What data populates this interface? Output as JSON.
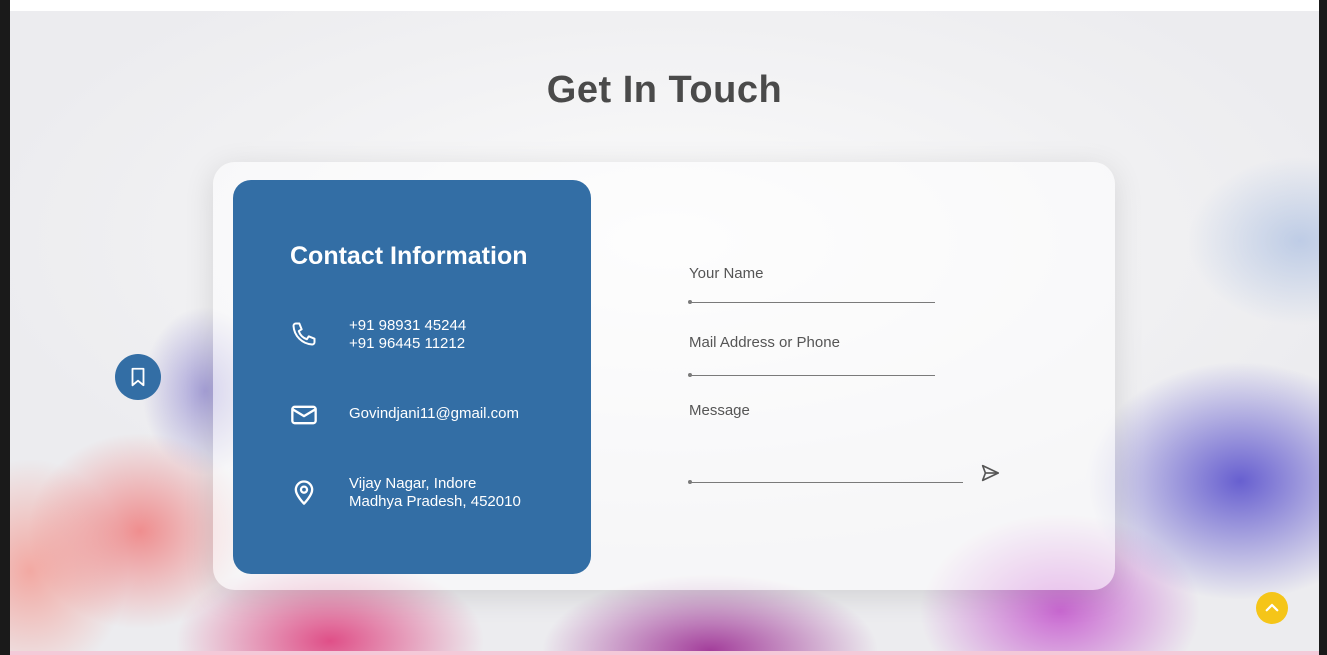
{
  "section": {
    "heading": "Get In Touch"
  },
  "contact_info": {
    "title": "Contact Information",
    "phone_1": "+91 98931 45244",
    "phone_2": "+91 96445 11212",
    "email": "Govindjani11@gmail.com",
    "address_line_1": "Vijay Nagar, Indore",
    "address_line_2": "Madhya Pradesh, 452010",
    "panel_color": "#336ea5"
  },
  "form": {
    "name_label": "Your Name",
    "contact_label": "Mail Address or Phone",
    "message_label": "Message",
    "send_icon": "send-icon"
  },
  "floating": {
    "bookmark_icon": "bookmark-icon",
    "scroll_top_icon": "chevron-up-icon",
    "scroll_top_color": "#f5c518"
  }
}
